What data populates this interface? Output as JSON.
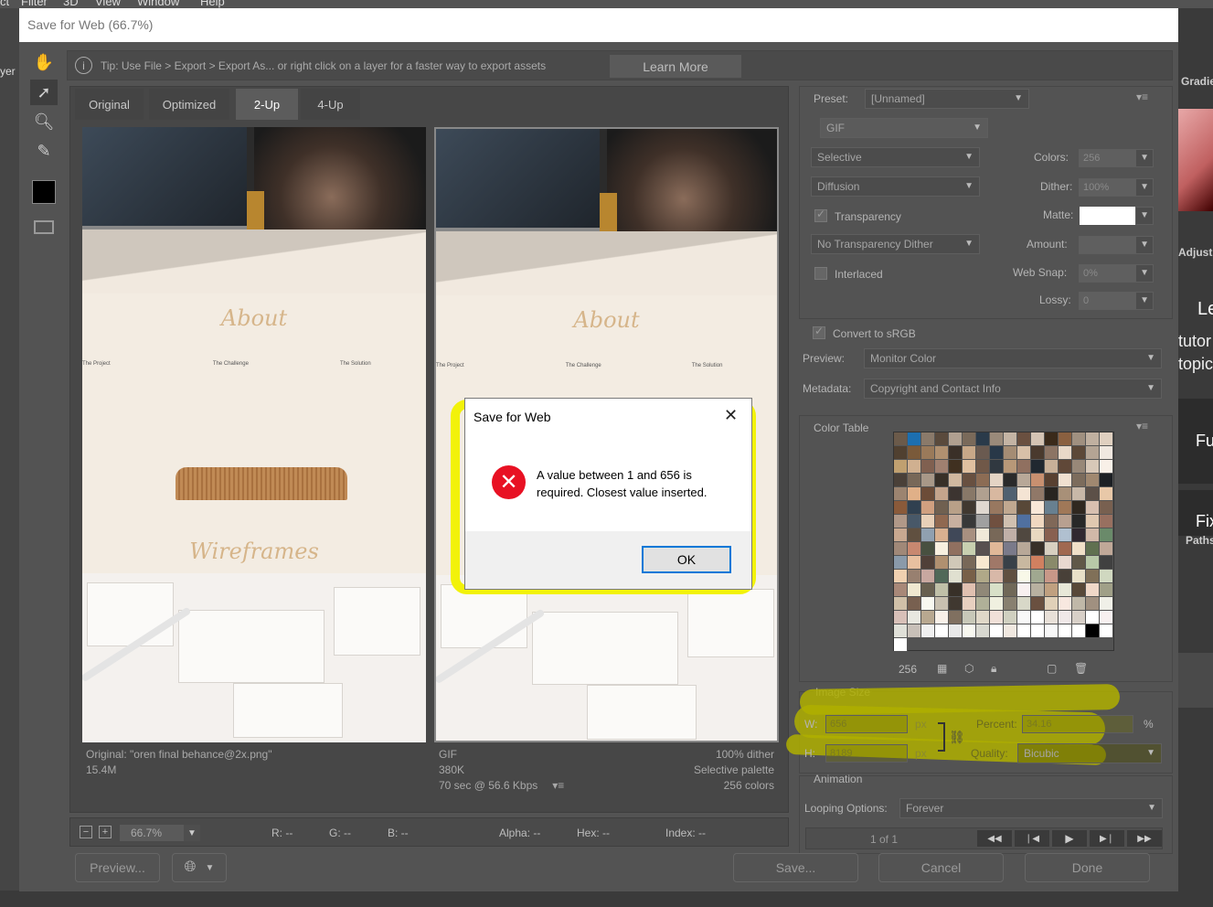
{
  "ps": {
    "menu": [
      "ct",
      "Filter",
      "3D",
      "View",
      "Window",
      "Help"
    ],
    "right_panels": [
      "yer",
      "Gradie",
      "Adjust",
      "Lea",
      "tutor",
      "topic",
      "Fu",
      "Fix",
      "Paths"
    ]
  },
  "dialog": {
    "title": "Save for Web (66.7%)",
    "tip": "Tip: Use File > Export > Export As...  or right click on a layer for a faster way to export assets",
    "learn_more": "Learn More",
    "tools": [
      "hand-icon",
      "slice-select-icon",
      "zoom-icon",
      "eyedropper-icon",
      "eyedropper-color-icon",
      "toggle-slices-icon"
    ]
  },
  "tabs": [
    "Original",
    "Optimized",
    "2-Up",
    "4-Up"
  ],
  "active_tab": "2-Up",
  "preview_art": {
    "about": "About",
    "wireframes": "Wireframes",
    "col1_title": "The Project",
    "col2_title": "The Challenge",
    "col3_title": "The Solution"
  },
  "left_info": {
    "line1": "Original: \"oren final behance@2x.png\"",
    "line2": "15.4M"
  },
  "right_info": {
    "format": "GIF",
    "size": "380K",
    "speed": "70 sec @ 56.6 Kbps",
    "dither": "100% dither",
    "palette": "Selective palette",
    "colors": "256 colors"
  },
  "status": {
    "zoom": "66.7%",
    "r": "R: --",
    "g": "G: --",
    "b": "B: --",
    "alpha": "Alpha: --",
    "hex": "Hex: --",
    "index": "Index: --"
  },
  "settings": {
    "preset_label": "Preset:",
    "preset_value": "[Unnamed]",
    "format": "GIF",
    "reduction": "Selective",
    "dither_algo": "Diffusion",
    "transparency_label": "Transparency",
    "transparency_dither": "No Transparency Dither",
    "interlaced_label": "Interlaced",
    "colors_label": "Colors:",
    "colors_value": "256",
    "dither_label": "Dither:",
    "dither_value": "100%",
    "matte_label": "Matte:",
    "amount_label": "Amount:",
    "amount_value": "",
    "websnap_label": "Web Snap:",
    "websnap_value": "0%",
    "lossy_label": "Lossy:",
    "lossy_value": "0",
    "convert_label": "Convert to sRGB",
    "preview_label": "Preview:",
    "preview_value": "Monitor Color",
    "metadata_label": "Metadata:",
    "metadata_value": "Copyright and Contact Info"
  },
  "color_table": {
    "title": "Color Table",
    "count": "256",
    "colors": [
      "#6b5a4a",
      "#1c6fb0",
      "#8a7a6a",
      "#5a4a3c",
      "#b0a090",
      "#7a6a5a",
      "#2a3a4a",
      "#9a8a7a",
      "#c4b4a4",
      "#6a5040",
      "#d4c4b4",
      "#3a2a1a",
      "#8a6040",
      "#a09080",
      "#c0b0a0",
      "#e0d0c0",
      "#504030",
      "#7a5a3a",
      "#9a7a5a",
      "#b09070",
      "#3a3028",
      "#c8a888",
      "#6a5a50",
      "#283848",
      "#a48c74",
      "#d8c0a8",
      "#4a3a2e",
      "#8c7464",
      "#e8d8c8",
      "#5c4838",
      "#b4a494",
      "#f0e8e0",
      "#c0a070",
      "#d0b090",
      "#806050",
      "#a08070",
      "#403020",
      "#e0c0a0",
      "#705848",
      "#303840",
      "#b89878",
      "#907060",
      "#202830",
      "#c8b098",
      "#604838",
      "#988878",
      "#d8c8b8",
      "#f8f0e8",
      "#4a4038",
      "#786858",
      "#a89888",
      "#383028",
      "#d0b8a0",
      "#685040",
      "#8c6c54",
      "#e4d4c4",
      "#2a2a2a",
      "#b8a898",
      "#c89070",
      "#584030",
      "#f0e0d0",
      "#7c6c5c",
      "#a08870",
      "#1c2024",
      "#9c8470",
      "#e0b088",
      "#6c4c38",
      "#c4a48c",
      "#3c3430",
      "#887868",
      "#b0a090",
      "#d8b8a0",
      "#506070",
      "#f4e4d4",
      "#907868",
      "#282420",
      "#a89078",
      "#c8b8a8",
      "#5c5048",
      "#e8c8a8",
      "#8a5a3a",
      "#304050",
      "#d0a080",
      "#706050",
      "#b8a088",
      "#403830",
      "#e0d8d0",
      "#987860",
      "#c0a890",
      "#584838",
      "#f8e8d8",
      "#688090",
      "#a07858",
      "#302820",
      "#d8c0b0",
      "#786050",
      "#b09888",
      "#485868",
      "#e8d0b8",
      "#906850",
      "#c8b0a0",
      "#383838",
      "#a0a0a0",
      "#705040",
      "#d0c0b0",
      "#5070a0",
      "#f0d8c0",
      "#806858",
      "#b8a090",
      "#282828",
      "#e0c8b0",
      "#987060",
      "#c8a890",
      "#605040",
      "#90a0b0",
      "#d8b090",
      "#404858",
      "#a89080",
      "#f0e8d8",
      "#786858",
      "#c0b0a8",
      "#504840",
      "#e8d8c0",
      "#886050",
      "#b0c0d0",
      "#302830",
      "#d0b8a8",
      "#6a8a6a",
      "#a08878",
      "#c88870",
      "#485040",
      "#f8f0e0",
      "#907060",
      "#c8d0b0",
      "#585050",
      "#e0b898",
      "#7a7a8a",
      "#b8a898",
      "#383028",
      "#d8d0c0",
      "#a06850",
      "#f0e0c8",
      "#607050",
      "#c0a898",
      "#8a9aaa",
      "#e8c0a0",
      "#504038",
      "#b09070",
      "#d0c8b8",
      "#786858",
      "#f8e8d0",
      "#a07868",
      "#384048",
      "#c8b8a0",
      "#d08060",
      "#8a8a6a",
      "#e8d8d0",
      "#605848",
      "#b8c8a8",
      "#404040",
      "#f0d0b0",
      "#988070",
      "#c8a8a0",
      "#506858",
      "#e0e0d0",
      "#786048",
      "#b0a888",
      "#d8b8a8",
      "#605040",
      "#f8f8e8",
      "#a0a890",
      "#c89888",
      "#484038",
      "#e8e0c8",
      "#807058",
      "#d0d8c0",
      "#a88878",
      "#f0e8d0",
      "#686050",
      "#c0c0a8",
      "#383028",
      "#e0c0b0",
      "#908878",
      "#d8e0c8",
      "#706858",
      "#f8f0f0",
      "#b8b0a0",
      "#c0a080",
      "#e8e8d8",
      "#584838",
      "#f0d8c8",
      "#a0a088",
      "#d0c0a8",
      "#786050",
      "#f8f8f0",
      "#c8c0b0",
      "#403830",
      "#e8d0c0",
      "#b0b098",
      "#f0f0e0",
      "#888070",
      "#d8d8c8",
      "#6a5040",
      "#e0d0b8",
      "#f8e8e0",
      "#c0b8a8",
      "#a09080",
      "#f0f0e8",
      "#d8c0b8",
      "#e8e8e0",
      "#b8a890",
      "#f8f0e8",
      "#807060",
      "#c8c8b8",
      "#e0d8c8",
      "#f0e0d8",
      "#d0d0c0",
      "#f8f8f8",
      "#ffffff",
      "#e8e0d8",
      "#f0e8e8",
      "#d8d0c8",
      "#ffffff",
      "#f8f0f0",
      "#e0e0d8",
      "#c8c0b8",
      "#f0f0f0",
      "#ffffff",
      "#e8e8e8",
      "#f8f8f0",
      "#d8d8d0",
      "#ffffff",
      "#f0e8e0",
      "#ffffff",
      "#ffffff",
      "#f8f8f8",
      "#ffffff",
      "#ffffff",
      "#000000",
      "#ffffff",
      "#ffffff"
    ]
  },
  "image_size": {
    "title": "Image Size",
    "w_label": "W:",
    "w_value": "656",
    "h_label": "H:",
    "h_value": "8189",
    "unit": "px",
    "percent_label": "Percent:",
    "percent_value": "34.16",
    "percent_unit": "%",
    "quality_label": "Quality:",
    "quality_value": "Bicubic"
  },
  "animation": {
    "title": "Animation",
    "looping_label": "Looping Options:",
    "looping_value": "Forever",
    "frame": "1 of 1"
  },
  "buttons": {
    "preview": "Preview...",
    "save": "Save...",
    "cancel": "Cancel",
    "done": "Done"
  },
  "alert": {
    "title": "Save for Web",
    "message": "A value between 1 and 656 is required. Closest value inserted.",
    "ok": "OK"
  }
}
